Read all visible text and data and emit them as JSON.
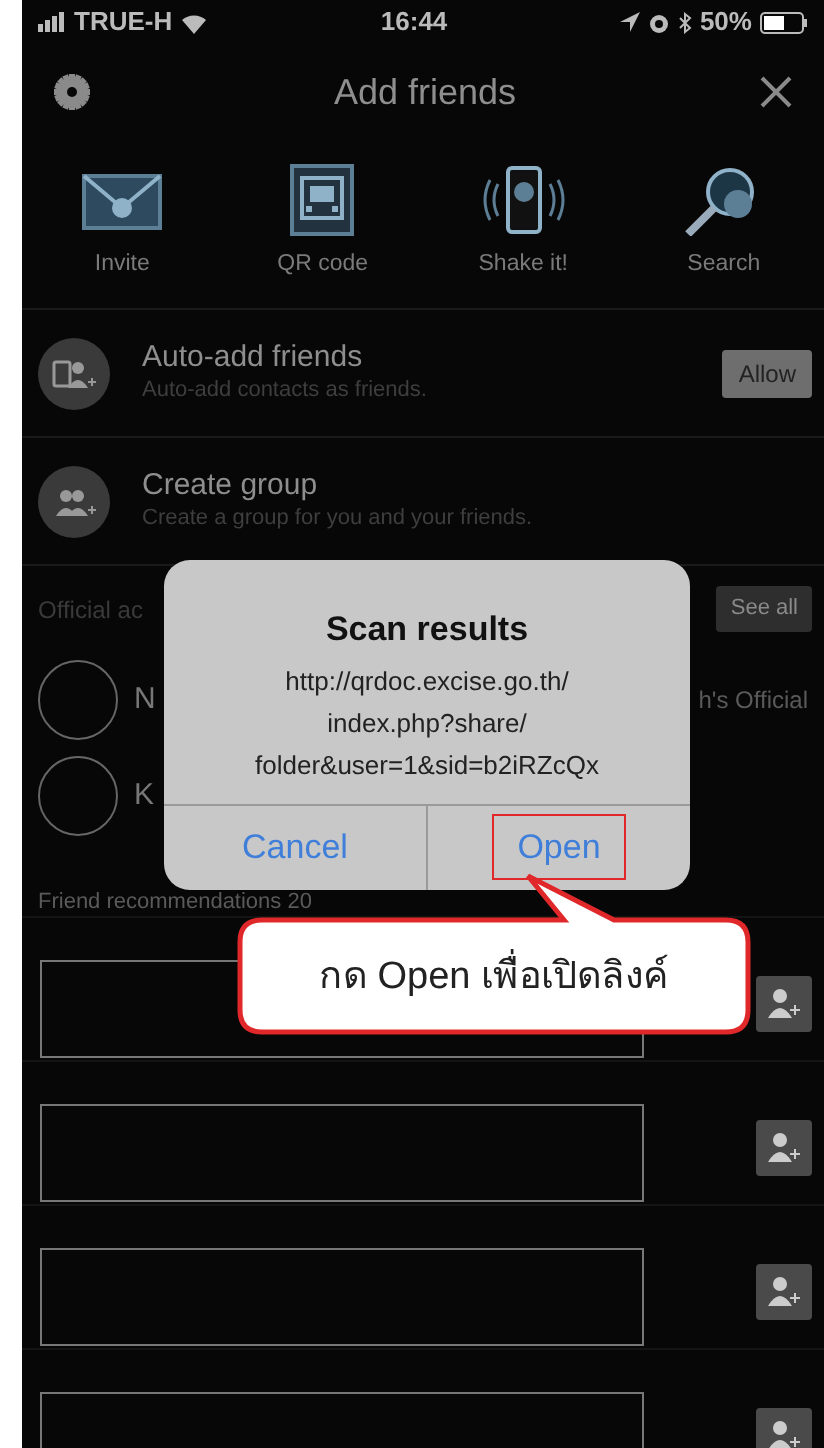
{
  "status_bar": {
    "carrier": "TRUE-H",
    "time": "16:44",
    "battery": "50%"
  },
  "header": {
    "title": "Add friends"
  },
  "actions": [
    {
      "kind": "envelope",
      "label": "Invite"
    },
    {
      "kind": "qr",
      "label": "QR code"
    },
    {
      "kind": "shake",
      "label": "Shake it!"
    },
    {
      "kind": "search",
      "label": "Search"
    }
  ],
  "features": [
    {
      "kind": "contacts",
      "title": "Auto-add friends",
      "subtitle": "Auto-add contacts as friends.",
      "button": "Allow"
    },
    {
      "kind": "group",
      "title": "Create group",
      "subtitle": "Create a group for you and your friends."
    }
  ],
  "official_accounts": {
    "heading": "Official ac",
    "button": "See all",
    "rows": [
      {
        "name": "N",
        "trailing": "h's Official"
      },
      {
        "name": "K"
      }
    ]
  },
  "friend_recommendations": {
    "heading": "Friend recommendations 20",
    "rows": [
      {
        "kind": "hidden"
      },
      {
        "kind": "hidden"
      },
      {
        "kind": "hidden"
      },
      {
        "kind": "hidden"
      }
    ]
  },
  "dialog": {
    "title": "Scan results",
    "message": [
      "http://qrdoc.excise.go.th/",
      "index.php?share/",
      "folder&user=1&sid=b2iRZcQx"
    ],
    "buttons": [
      {
        "label": "Cancel",
        "highlighted": false
      },
      {
        "label": "Open",
        "highlighted": true
      }
    ]
  },
  "callout": {
    "text": "กด Open เพื่อเปิดลิงค์"
  }
}
